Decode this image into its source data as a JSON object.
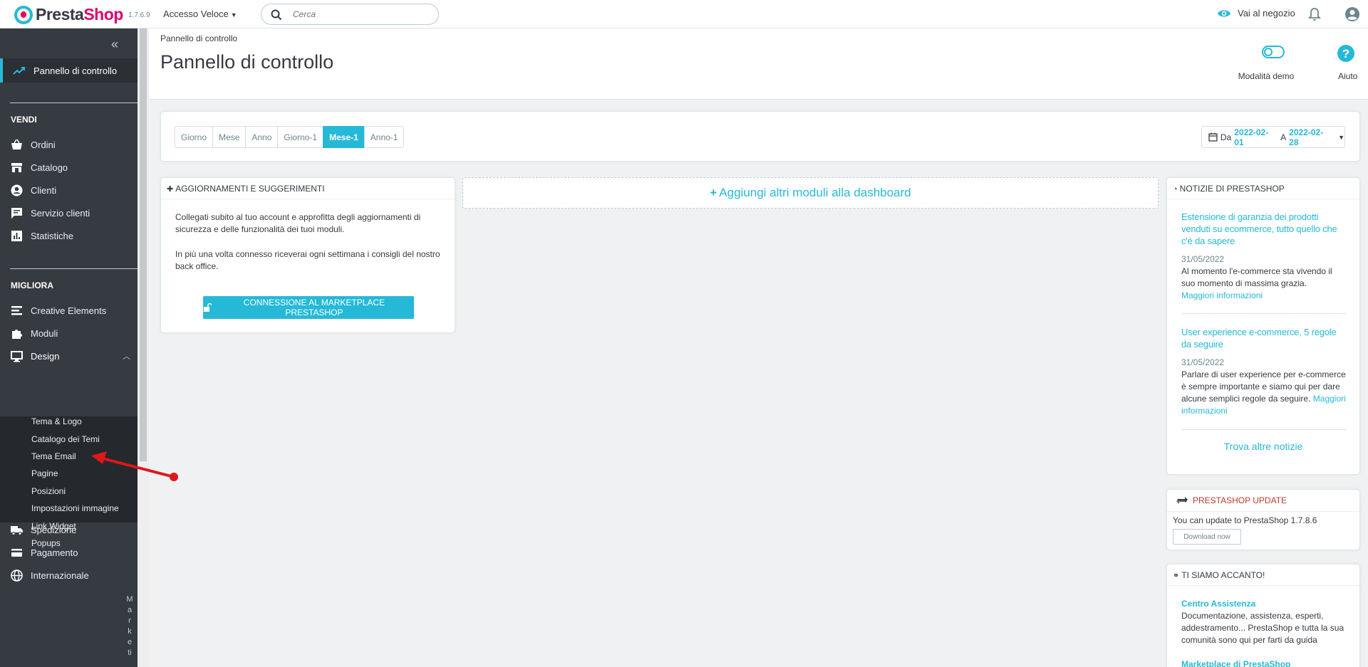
{
  "header": {
    "brand_presta": "Presta",
    "brand_shop": "Shop",
    "version": "1.7.6.9",
    "quick_access": "Accesso Veloce",
    "search_placeholder": "Cerca",
    "view_shop": "Vai al negozio"
  },
  "sidebar": {
    "dashboard": "Pannello di controllo",
    "sections": {
      "sell": "VENDI",
      "improve": "MIGLIORA"
    },
    "sell_items": [
      "Ordini",
      "Catalogo",
      "Clienti",
      "Servizio clienti",
      "Statistiche"
    ],
    "improve_items": [
      "Creative Elements",
      "Moduli",
      "Design"
    ],
    "design_subitems": [
      "Tema & Logo",
      "Catalogo dei Temi",
      "Tema Email",
      "Pagine",
      "Posizioni",
      "Impostazioni immagine",
      "Link Widget",
      "Popups"
    ],
    "more_items": [
      "Spedizione",
      "Pagamento",
      "Internazionale"
    ],
    "vertical_label": [
      "M",
      "a",
      "r",
      "k",
      "e",
      "ti"
    ]
  },
  "page": {
    "breadcrumb": "Pannello di controllo",
    "title": "Pannello di controllo",
    "demo_mode": "Modalità demo",
    "help": "Aiuto"
  },
  "date_filter": {
    "ranges": [
      "Giorno",
      "Mese",
      "Anno",
      "Giorno-1",
      "Mese-1",
      "Anno-1"
    ],
    "active_range": "Mese-1",
    "from_label": "Da",
    "from_date": "2022-02-01",
    "to_label": "A",
    "to_date": "2022-02-28"
  },
  "updates_panel": {
    "title": "AGGIORNAMENTI E SUGGERIMENTI",
    "paragraph1": "Collegati subito al tuo account e approfitta degli aggiornamenti di sicurezza e delle funzionalità dei tuoi moduli.",
    "paragraph2": "In più una volta connesso riceverai ogni settimana i consigli del nostro back office.",
    "button": "CONNESSIONE AL MARKETPLACE PRESTASHOP"
  },
  "add_modules": "Aggiungi altri moduli alla dashboard",
  "news_panel": {
    "title": "NOTIZIE DI PRESTASHOP",
    "items": [
      {
        "title": "Estensione di garanzia dei prodotti venduti su ecommerce, tutto quello che c'è da sapere",
        "date": "31/05/2022",
        "body": "Al momento l'e-commerce sta vivendo il suo momento di massima grazia.",
        "more": "Maggiori informazioni"
      },
      {
        "title": "User experience e-commerce, 5 regole da seguire",
        "date": "31/05/2022",
        "body": "Parlare di user experience per e-commerce è sempre importante e siamo qui per dare alcune semplici regole da seguire.",
        "more": "Maggiori informazioni"
      }
    ],
    "find_more": "Trova altre notizie"
  },
  "update_panel": {
    "title": "PRESTASHOP UPDATE",
    "message": "You can update to PrestaShop 1.7.8.6",
    "button": "Download now"
  },
  "near_panel": {
    "title": "TI SIAMO ACCANTO!",
    "items": [
      {
        "title": "Centro Assistenza",
        "body": "Documentazione, assistenza, esperti, addestramento... PrestaShop e tutta la sua comunità sono qui per farti da guida"
      },
      {
        "title": "Marketplace di PrestaShop",
        "body": ""
      }
    ]
  },
  "colors": {
    "accent": "#25b9d7",
    "sidebar_bg": "#363a41",
    "brand_pink": "#df0067",
    "annotation_arrow": "#e0171a"
  }
}
